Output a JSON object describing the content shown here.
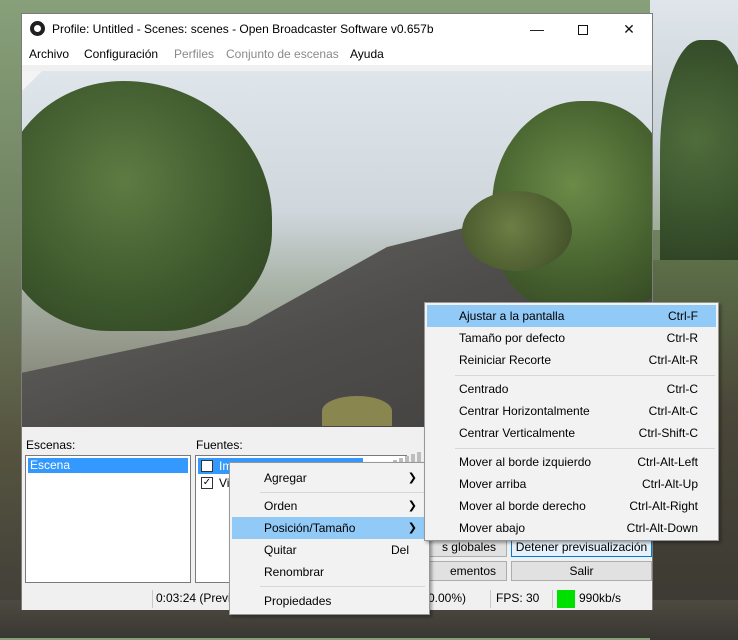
{
  "window": {
    "title": "Profile: Untitled - Scenes: scenes - Open Broadcaster Software v0.657b",
    "controls": {
      "minimize": "—",
      "close": "✕"
    }
  },
  "menubar": {
    "items": [
      {
        "label": "Archivo",
        "enabled": true
      },
      {
        "label": "Configuración",
        "enabled": true
      },
      {
        "label": "Perfiles",
        "enabled": false
      },
      {
        "label": "Conjunto de escenas",
        "enabled": false
      },
      {
        "label": "Ayuda",
        "enabled": true
      }
    ]
  },
  "scenes": {
    "label": "Escenas:",
    "items": [
      "Escena"
    ]
  },
  "sources": {
    "label": "Fuentes:",
    "items": [
      {
        "name": "Im",
        "checked": true,
        "selected": true
      },
      {
        "name": "Vi",
        "checked": true,
        "selected": false
      }
    ]
  },
  "buttons": {
    "global_sources": "s globales",
    "stop_preview": "Detener previsualización",
    "plugins": "ementos",
    "exit": "Salir"
  },
  "status": {
    "time": "0:03:24 (Previe",
    "dropped": "0.00%)",
    "fps": "FPS: 30",
    "bitrate": "990kb/s",
    "stream_color": "#00e000"
  },
  "context_menu": {
    "items": [
      {
        "label": "Agregar",
        "shortcut": "",
        "submenu": true
      },
      {
        "label": "Orden",
        "shortcut": "",
        "submenu": true
      },
      {
        "label": "Posición/Tamaño",
        "shortcut": "",
        "submenu": true,
        "highlighted": true
      },
      {
        "label": "Quitar",
        "shortcut": "Del"
      },
      {
        "label": "Renombrar",
        "shortcut": ""
      },
      {
        "label": "Propiedades",
        "shortcut": ""
      }
    ]
  },
  "position_submenu": {
    "items": [
      {
        "label": "Ajustar a la pantalla",
        "shortcut": "Ctrl-F",
        "highlighted": true
      },
      {
        "label": "Tamaño por defecto",
        "shortcut": "Ctrl-R"
      },
      {
        "label": "Reiniciar Recorte",
        "shortcut": "Ctrl-Alt-R"
      },
      {
        "label": "Centrado",
        "shortcut": "Ctrl-C"
      },
      {
        "label": "Centrar Horizontalmente",
        "shortcut": "Ctrl-Alt-C"
      },
      {
        "label": "Centrar Verticalmente",
        "shortcut": "Ctrl-Shift-C"
      },
      {
        "label": "Mover al borde izquierdo",
        "shortcut": "Ctrl-Alt-Left"
      },
      {
        "label": "Mover arriba",
        "shortcut": "Ctrl-Alt-Up"
      },
      {
        "label": "Mover al borde derecho",
        "shortcut": "Ctrl-Alt-Right"
      },
      {
        "label": "Mover abajo",
        "shortcut": "Ctrl-Alt-Down"
      }
    ]
  },
  "colors": {
    "selection": "#3399ff",
    "menu_highlight": "#91c9f7",
    "focus_border": "#0078d7"
  }
}
